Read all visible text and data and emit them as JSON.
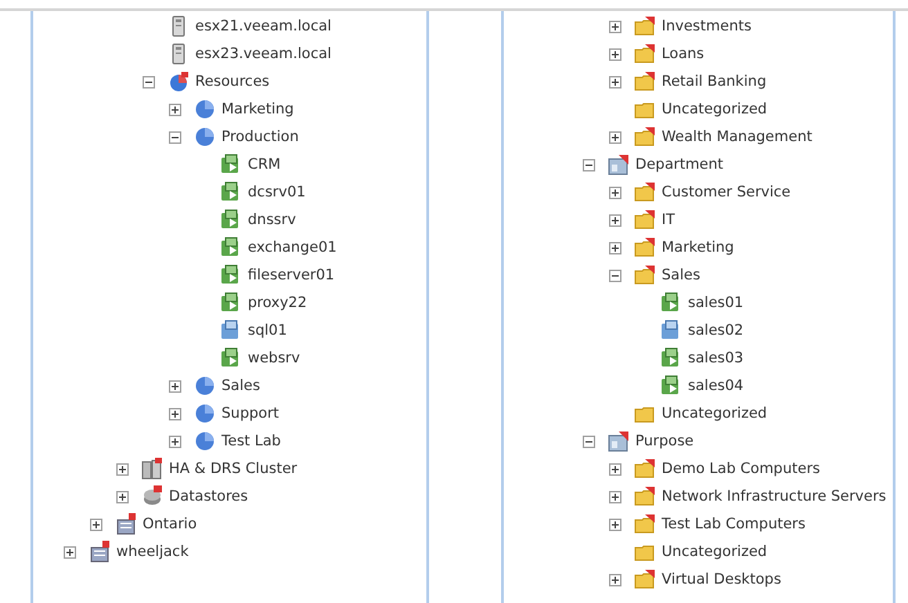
{
  "panes": [
    {
      "tree": [
        {
          "children": [
            {
              "children": [
                {
                  "children": [
                    {
                      "label": "esx21.veeam.local",
                      "kind": "host"
                    },
                    {
                      "label": "esx23.veeam.local",
                      "kind": "host"
                    },
                    {
                      "label": "Resources",
                      "kind": "pool-root",
                      "expanded": true,
                      "children": [
                        {
                          "label": "Marketing",
                          "kind": "pool",
                          "expanded": false
                        },
                        {
                          "label": "Production",
                          "kind": "pool",
                          "expanded": true,
                          "children": [
                            {
                              "label": "CRM",
                              "kind": "vm"
                            },
                            {
                              "label": "dcsrv01",
                              "kind": "vm"
                            },
                            {
                              "label": "dnssrv",
                              "kind": "vm"
                            },
                            {
                              "label": "exchange01",
                              "kind": "vm"
                            },
                            {
                              "label": "fileserver01",
                              "kind": "vm"
                            },
                            {
                              "label": "proxy22",
                              "kind": "vm"
                            },
                            {
                              "label": "sql01",
                              "kind": "vm-off"
                            },
                            {
                              "label": "websrv",
                              "kind": "vm"
                            }
                          ]
                        },
                        {
                          "label": "Sales",
                          "kind": "pool",
                          "expanded": false
                        },
                        {
                          "label": "Support",
                          "kind": "pool",
                          "expanded": false
                        },
                        {
                          "label": "Test Lab",
                          "kind": "pool",
                          "expanded": false
                        }
                      ]
                    }
                  ]
                },
                {
                  "label": "HA & DRS Cluster",
                  "kind": "cluster",
                  "expanded": false
                },
                {
                  "label": "Datastores",
                  "kind": "datastores",
                  "expanded": false
                }
              ]
            },
            {
              "label": "Ontario",
              "kind": "datacenter",
              "expanded": false
            }
          ]
        },
        {
          "label": "wheeljack",
          "kind": "datacenter",
          "expanded": false
        }
      ]
    },
    {
      "tree": [
        {
          "children": [
            {
              "label": "Investments",
              "kind": "tag-folder",
              "expanded": false
            },
            {
              "label": "Loans",
              "kind": "tag-folder",
              "expanded": false
            },
            {
              "label": "Retail Banking",
              "kind": "tag-folder",
              "expanded": false
            },
            {
              "label": "Uncategorized",
              "kind": "folder"
            },
            {
              "label": "Wealth Management",
              "kind": "tag-folder",
              "expanded": false
            }
          ]
        },
        {
          "label": "Department",
          "kind": "category",
          "expanded": true,
          "children": [
            {
              "label": "Customer Service",
              "kind": "tag-folder",
              "expanded": false
            },
            {
              "label": "IT",
              "kind": "tag-folder",
              "expanded": false
            },
            {
              "label": "Marketing",
              "kind": "tag-folder",
              "expanded": false
            },
            {
              "label": "Sales",
              "kind": "tag-folder",
              "expanded": true,
              "children": [
                {
                  "label": "sales01",
                  "kind": "vm"
                },
                {
                  "label": "sales02",
                  "kind": "vm-off"
                },
                {
                  "label": "sales03",
                  "kind": "vm"
                },
                {
                  "label": "sales04",
                  "kind": "vm"
                }
              ]
            },
            {
              "label": "Uncategorized",
              "kind": "folder"
            }
          ]
        },
        {
          "label": "Purpose",
          "kind": "category",
          "expanded": true,
          "children": [
            {
              "label": "Demo Lab Computers",
              "kind": "tag-folder",
              "expanded": false
            },
            {
              "label": "Network Infrastructure Servers",
              "kind": "tag-folder",
              "expanded": false
            },
            {
              "label": "Test Lab Computers",
              "kind": "tag-folder",
              "expanded": false
            },
            {
              "label": "Uncategorized",
              "kind": "folder"
            },
            {
              "label": "Virtual Desktops",
              "kind": "tag-folder",
              "expanded": false
            }
          ]
        }
      ]
    }
  ]
}
